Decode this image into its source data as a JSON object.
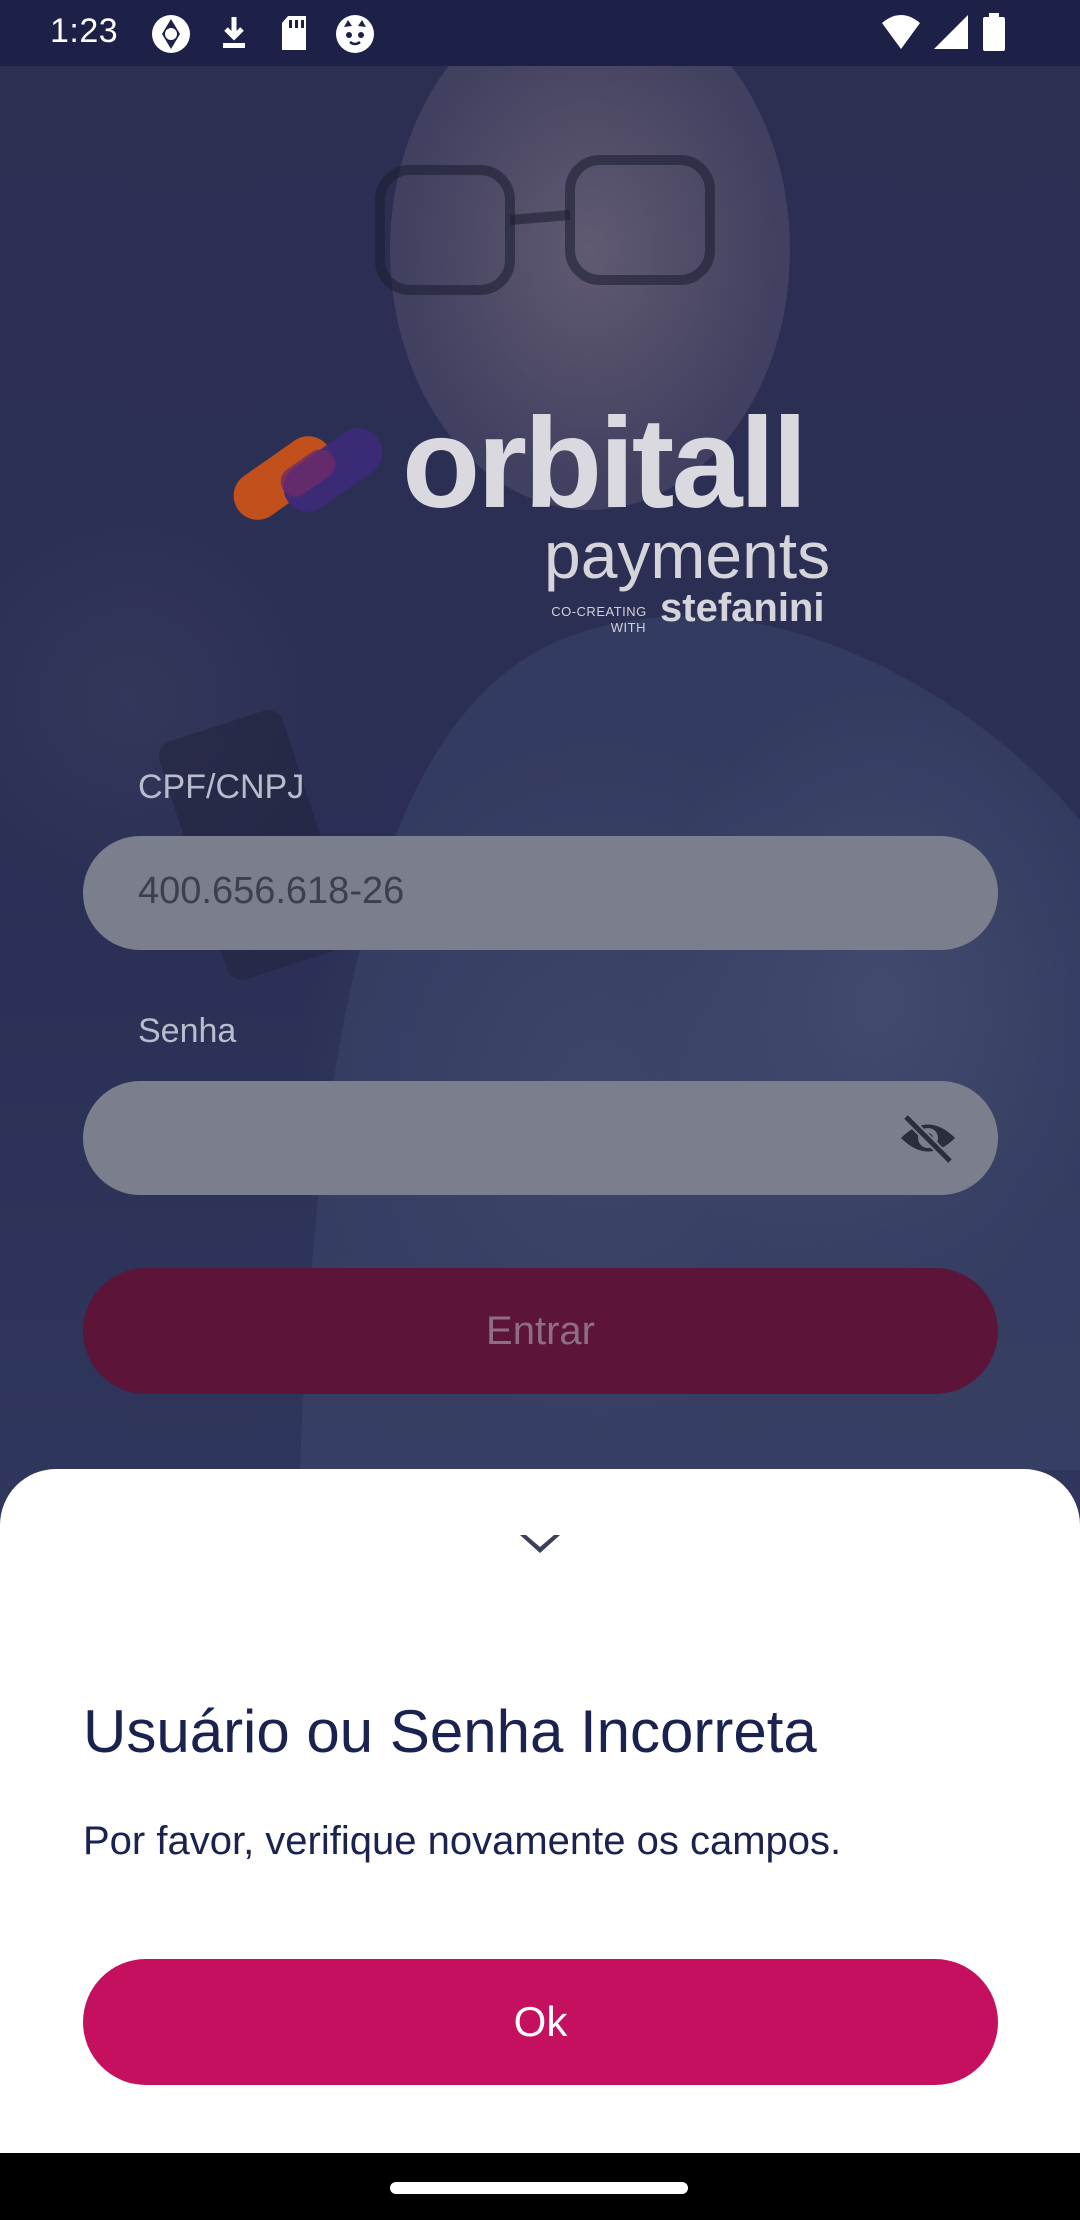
{
  "status_bar": {
    "time": "1:23",
    "left_icons": [
      "camera-shutter-icon",
      "download-icon",
      "sd-card-icon",
      "cat-face-icon"
    ],
    "right_icons": [
      "wifi-icon",
      "signal-icon",
      "battery-icon"
    ]
  },
  "logo": {
    "wordmark": "orbitall",
    "sub": "payments",
    "cocreating_line1": "CO-CREATING",
    "cocreating_line2": "WITH",
    "partner": "stefanini"
  },
  "form": {
    "cpf_label": "CPF/CNPJ",
    "cpf_value": "400.656.618-26",
    "password_label": "Senha",
    "password_value": "",
    "password_toggle_icon": "eye-off-icon",
    "login_button": "Entrar"
  },
  "sheet": {
    "handle_icon": "chevron-down-icon",
    "title": "Usuário ou Senha Incorreta",
    "message": "Por favor, verifique novamente os campos.",
    "ok_button": "Ok"
  },
  "colors": {
    "accent": "#c4105f",
    "text_dark": "#1a2250",
    "status_bar": "#1d2147"
  }
}
